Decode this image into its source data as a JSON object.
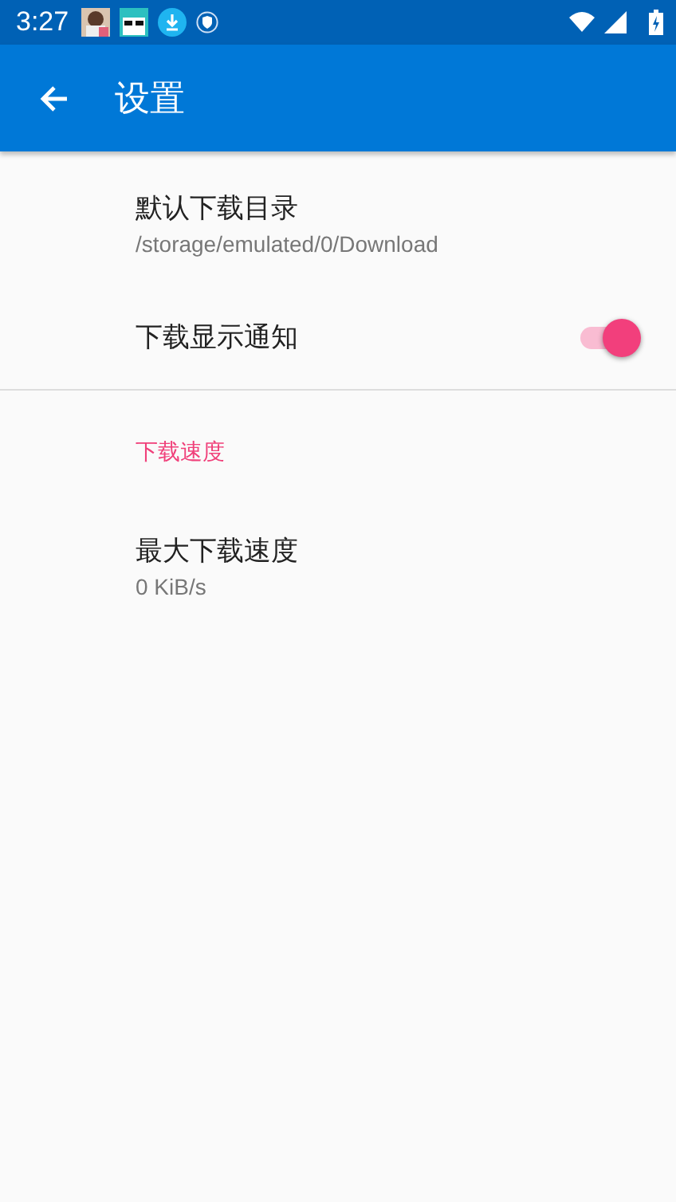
{
  "status_bar": {
    "time": "3:27"
  },
  "app_bar": {
    "title": "设置"
  },
  "sections": [
    {
      "items": [
        {
          "kind": "text",
          "title": "默认下载目录",
          "summary": "/storage/emulated/0/Download"
        },
        {
          "kind": "switch",
          "title": "下载显示通知",
          "on": true
        }
      ]
    },
    {
      "header": "下载速度",
      "items": [
        {
          "kind": "text",
          "title": "最大下载速度",
          "summary": "0 KiB/s"
        }
      ]
    }
  ]
}
